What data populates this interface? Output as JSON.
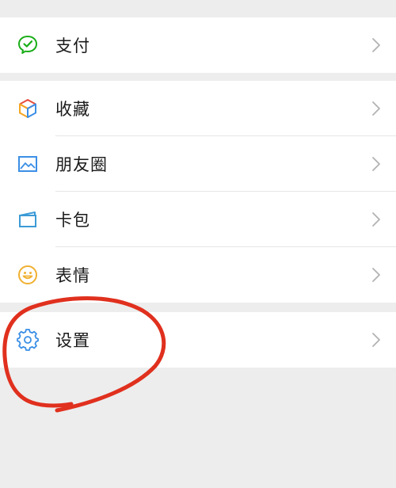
{
  "menu": {
    "pay": {
      "label": "支付",
      "icon": "wechat-pay-icon"
    },
    "items": [
      {
        "label": "收藏",
        "icon": "favorites-cube-icon"
      },
      {
        "label": "朋友圈",
        "icon": "moments-image-icon"
      },
      {
        "label": "卡包",
        "icon": "card-wallet-icon"
      },
      {
        "label": "表情",
        "icon": "sticker-smile-icon"
      }
    ],
    "settings": {
      "label": "设置",
      "icon": "gear-icon"
    }
  },
  "colors": {
    "background": "#ededed",
    "pay_green": "#1aad19",
    "annotation_red": "#e0301e"
  }
}
